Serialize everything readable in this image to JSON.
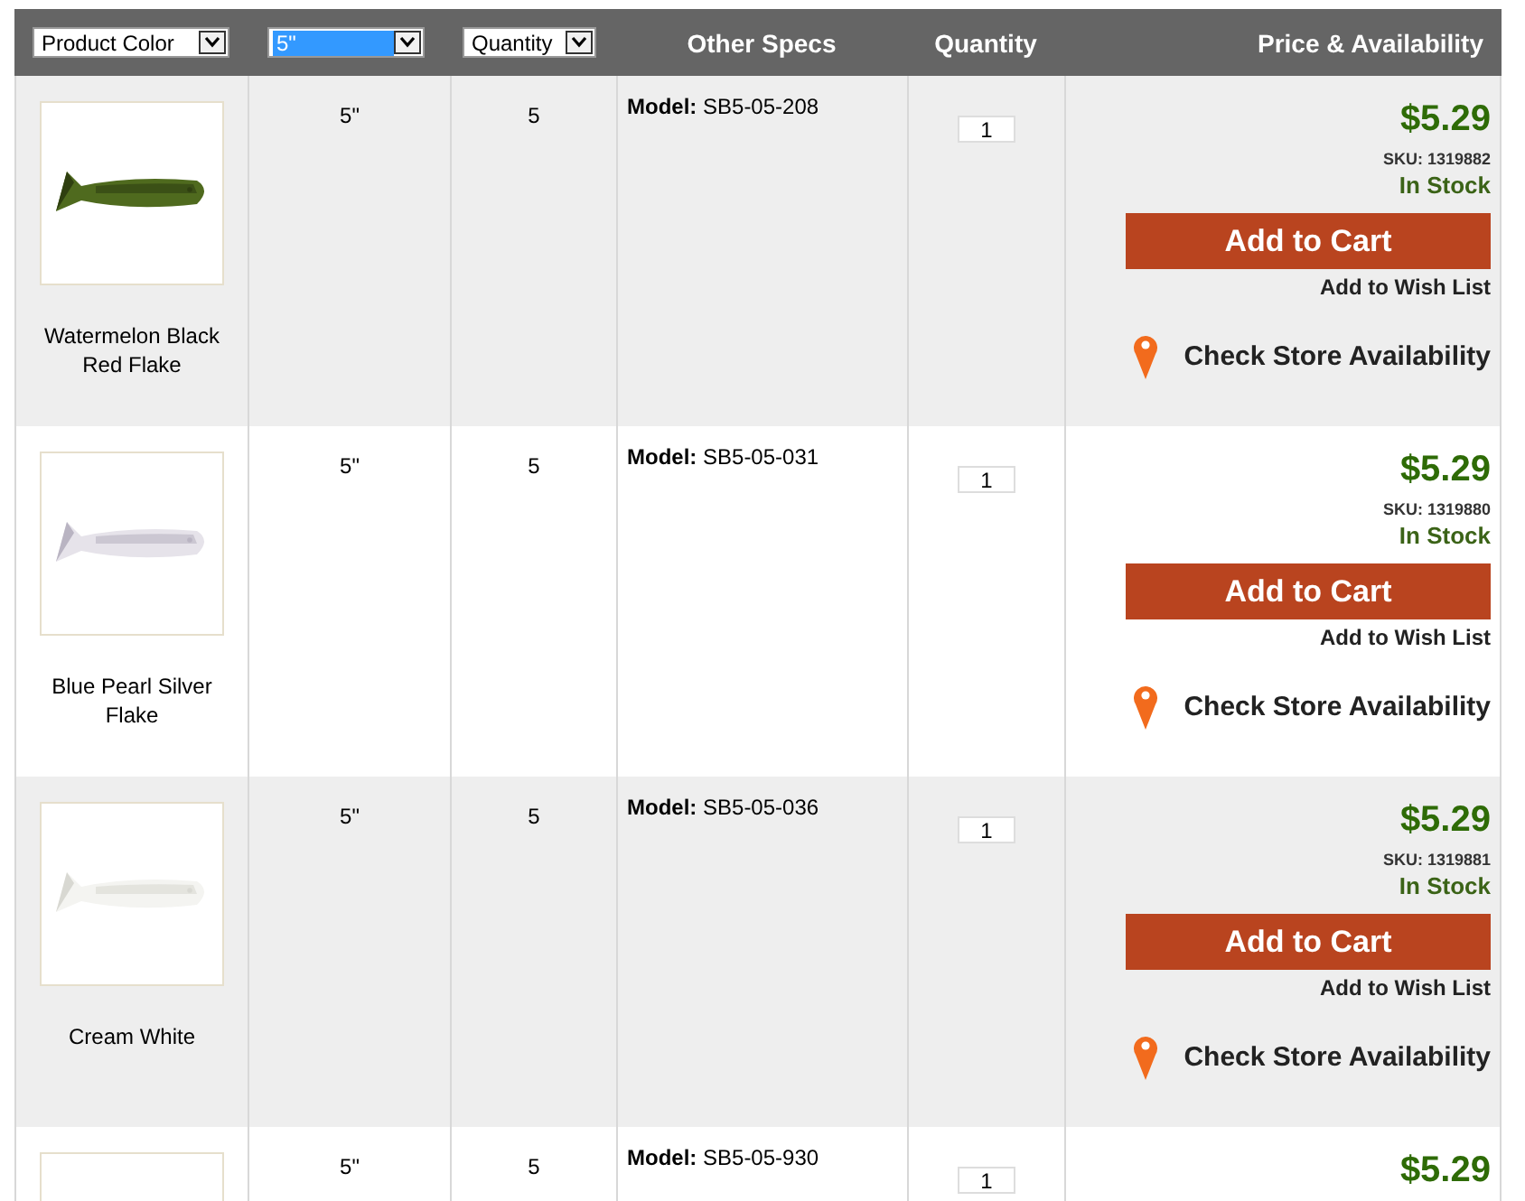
{
  "header": {
    "filters": [
      {
        "value": "Product Color",
        "highlighted": false
      },
      {
        "value": "5\"",
        "highlighted": true
      },
      {
        "value": "Quantity",
        "highlighted": false
      }
    ],
    "columns": [
      "Other Specs",
      "Quantity",
      "Price & Availability"
    ]
  },
  "rows": [
    {
      "name": "Watermelon Black Red Flake",
      "size": "5\"",
      "count": "5",
      "model": "**Model:** SB5-05-208",
      "quantity": "1",
      "price": "$5.29",
      "sku": "SKU: 1319882",
      "stock": "In Stock",
      "cart": "Add to Cart",
      "wishlist": "Add to Wish List",
      "store": "Check Store Availability"
    },
    {
      "name": "Blue Pearl Silver Flake",
      "size": "5\"",
      "count": "5",
      "model": "**Model:** SB5-05-031",
      "quantity": "1",
      "price": "$5.29",
      "sku": "SKU: 1319880",
      "stock": "In Stock",
      "cart": "Add to Cart",
      "wishlist": "Add to Wish List",
      "store": "Check Store Availability"
    },
    {
      "name": "Cream White",
      "size": "5\"",
      "count": "5",
      "model": "**Model:** SB5-05-036",
      "quantity": "1",
      "price": "$5.29",
      "sku": "SKU: 1319881",
      "stock": "In Stock",
      "cart": "Add to Cart",
      "wishlist": "Add to Wish List",
      "store": "Check Store Availability"
    },
    {
      "size": "5\"",
      "count": "5",
      "model": "**Model:** SB5-05-930",
      "quantity": "1",
      "price": "$5.29"
    }
  ]
}
